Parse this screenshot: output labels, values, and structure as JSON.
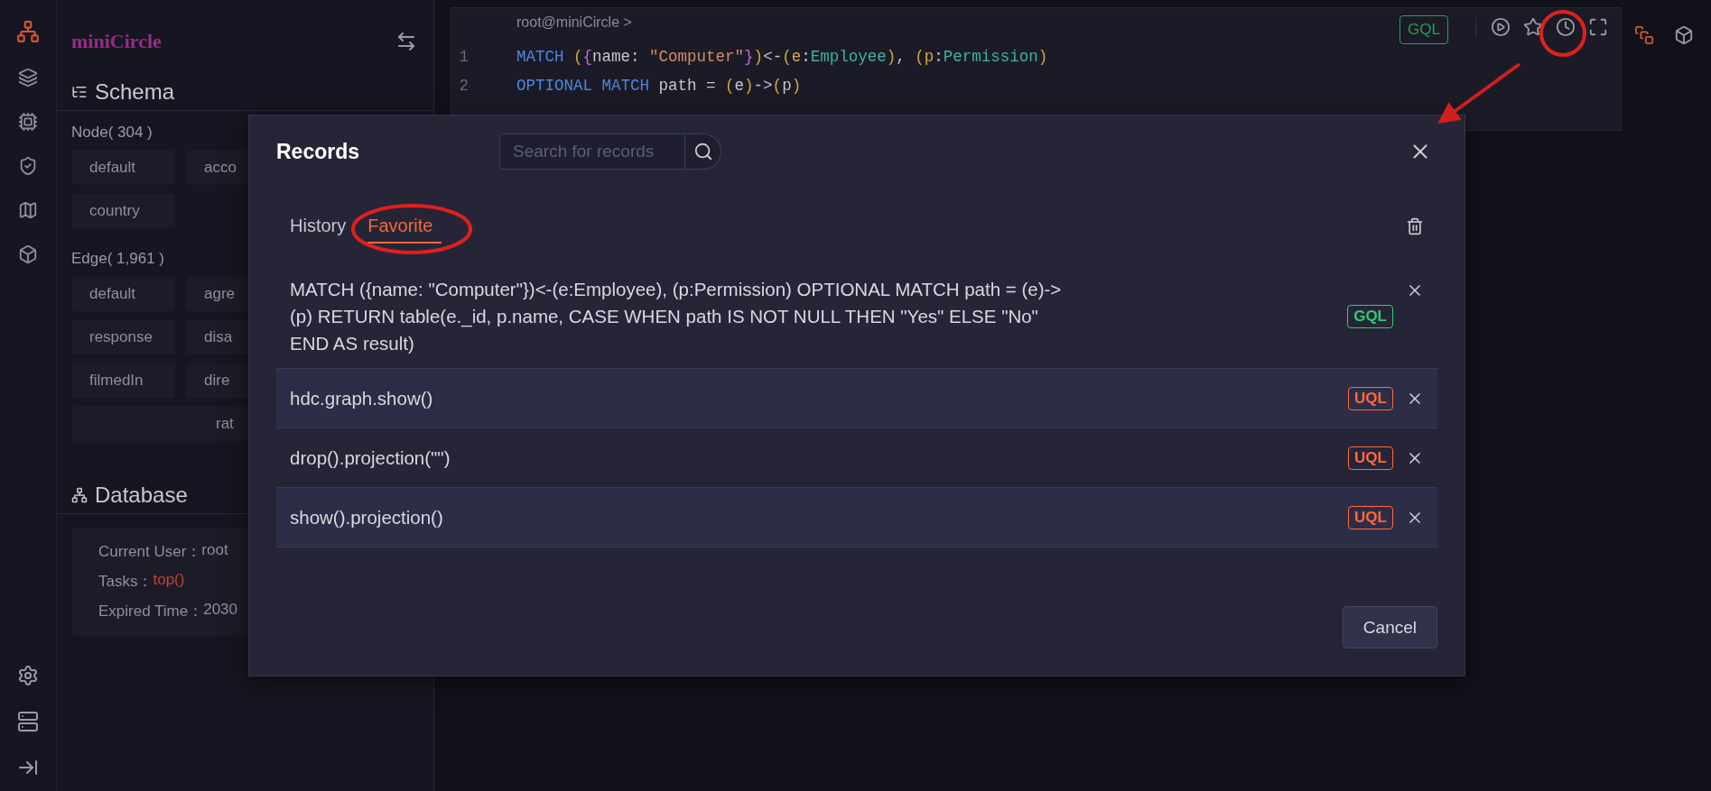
{
  "sidebar": {
    "logo": "miniCircle",
    "schema": {
      "title": "Schema",
      "node_heading": "Node( 304 )",
      "node_rows": [
        {
          "chips": [
            "default",
            "acco"
          ]
        },
        {
          "chips": [
            "country"
          ]
        }
      ],
      "edge_heading": "Edge( 1,961 )",
      "edge_rows": [
        {
          "chips": [
            "default",
            "agre"
          ]
        },
        {
          "chips": [
            "response",
            "disa"
          ]
        },
        {
          "chips": [
            "filmedIn",
            "dire"
          ]
        },
        {
          "chips": [
            "rat"
          ]
        }
      ]
    },
    "database": {
      "title": "Database",
      "lines": [
        {
          "label": "Current User：",
          "value": "root",
          "kind": "plain"
        },
        {
          "label": "Tasks：",
          "value": "top()",
          "kind": "link"
        },
        {
          "label": "Expired Time：",
          "value": "2030",
          "kind": "plain"
        }
      ]
    }
  },
  "editor": {
    "prompt": "root@miniCircle >",
    "language": {
      "label": "GQL",
      "color": "#2a9d56"
    },
    "lines": [
      {
        "number": "1",
        "tokens": [
          {
            "text": "MATCH ",
            "kind": "keyword"
          },
          {
            "text": "(",
            "kind": "bracket"
          },
          {
            "text": "{",
            "kind": "brace"
          },
          {
            "text": "name: ",
            "kind": "plain"
          },
          {
            "text": "\"Computer\"",
            "kind": "string"
          },
          {
            "text": "}",
            "kind": "brace"
          },
          {
            "text": ")",
            "kind": "bracket"
          },
          {
            "text": "<-",
            "kind": "plain"
          },
          {
            "text": "(",
            "kind": "bracket"
          },
          {
            "text": "e",
            "kind": "var"
          },
          {
            "text": ":",
            "kind": "plain"
          },
          {
            "text": "Employee",
            "kind": "label"
          },
          {
            "text": ")",
            "kind": "bracket"
          },
          {
            "text": ", ",
            "kind": "plain"
          },
          {
            "text": "(",
            "kind": "bracket"
          },
          {
            "text": "p",
            "kind": "var"
          },
          {
            "text": ":",
            "kind": "plain"
          },
          {
            "text": "Permission",
            "kind": "label"
          },
          {
            "text": ")",
            "kind": "bracket"
          }
        ]
      },
      {
        "number": "2",
        "tokens": [
          {
            "text": "OPTIONAL MATCH ",
            "kind": "keyword"
          },
          {
            "text": "path = ",
            "kind": "plain"
          },
          {
            "text": "(",
            "kind": "bracket"
          },
          {
            "text": "e",
            "kind": "plain"
          },
          {
            "text": ")",
            "kind": "bracket"
          },
          {
            "text": "->",
            "kind": "plain"
          },
          {
            "text": "(",
            "kind": "bracket"
          },
          {
            "text": "p",
            "kind": "plain"
          },
          {
            "text": ")",
            "kind": "bracket"
          }
        ]
      }
    ]
  },
  "modal": {
    "title": "Records",
    "search": {
      "placeholder": "Search for records"
    },
    "tabs": [
      {
        "label": "History",
        "selected": false
      },
      {
        "label": "Favorite",
        "selected": true
      }
    ],
    "records": [
      {
        "query": "MATCH ({name: \"Computer\"})<-(e:Employee), (p:Permission) OPTIONAL MATCH path = (e)->(p) RETURN table(e._id, p.name, CASE WHEN path IS NOT NULL THEN \"Yes\" ELSE \"No\" END AS result)",
        "language": "GQL",
        "color": "#2ecc71"
      },
      {
        "query": "hdc.graph.show()",
        "language": "UQL",
        "color": "#ff6a3d"
      },
      {
        "query": "drop().projection(\"\")",
        "language": "UQL",
        "color": "#ff6a3d"
      },
      {
        "query": "show().projection()",
        "language": "UQL",
        "color": "#ff6a3d"
      }
    ],
    "cancel": "Cancel"
  }
}
